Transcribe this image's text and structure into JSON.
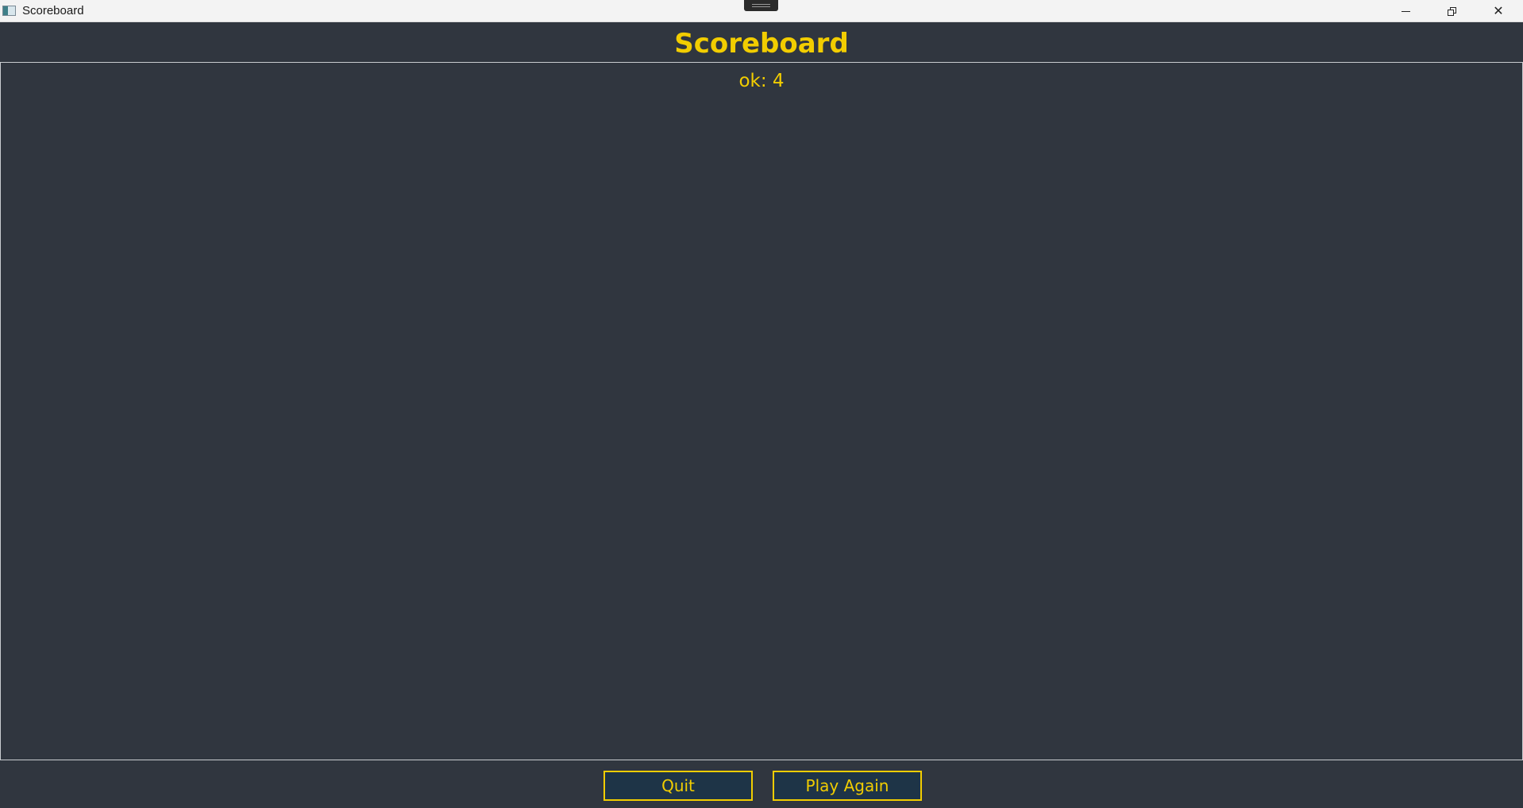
{
  "window": {
    "title": "Scoreboard",
    "icon": "app-icon",
    "controls": {
      "minimize_icon": "minimize-icon",
      "restore_icon": "restore-icon",
      "close_icon": "close-icon",
      "close_glyph": "✕"
    }
  },
  "header": {
    "title": "Scoreboard"
  },
  "scores": [
    {
      "text": "ok: 4"
    }
  ],
  "actions": {
    "quit_label": "Quit",
    "play_again_label": "Play Again"
  },
  "colors": {
    "background": "#30363f",
    "accent": "#f2cd00",
    "button_fill": "#1e3447",
    "panel_border": "#c9ccd0"
  }
}
